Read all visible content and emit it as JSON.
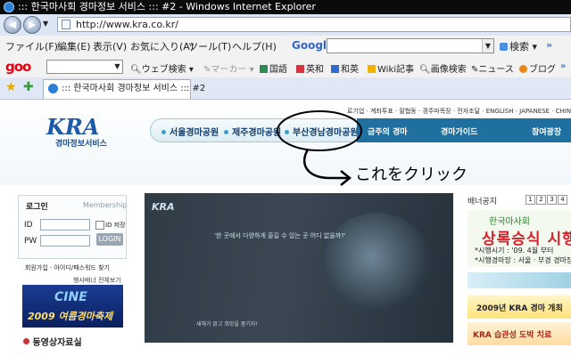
{
  "window": {
    "title": "::: 한국마사회 경마정보 서비스 ::: #2 - Windows Internet Explorer"
  },
  "address": {
    "url": "http://www.kra.co.kr/"
  },
  "menu": [
    "ファイル(F)",
    "編集(E)",
    "表示(V)",
    "お気に入り(A)",
    "ツール(T)",
    "ヘルプ(H)"
  ],
  "google": {
    "logo": "Google",
    "search_label": "検索"
  },
  "goo": {
    "logo": "goo",
    "web_search": "ウェブ検索",
    "marker": "マーカー",
    "items": [
      "国語",
      "英和",
      "和英",
      "Wiki記事",
      "画像検索",
      "ニュース",
      "ブログ"
    ]
  },
  "tab": {
    "title": "::: 한국마사회 경마정보 서비스 ::: #2"
  },
  "page": {
    "logo": "KRA",
    "logo_sub": "경마정보서비스",
    "util_links": "로기업 · 계좌투표 · 말협동 · 경주마목장 · 전자조달 · ENGLISH · JAPANESE · CHINESE",
    "parks": [
      "서울경마공원",
      "제주경마공원",
      "부산경남경마공원"
    ],
    "nav": [
      "금주의 경마",
      "경마가이드",
      "참여광장"
    ],
    "annotation": "これをクリック",
    "login": {
      "title": "로그인",
      "membership": "Membership",
      "id_label": "ID",
      "pw_label": "PW",
      "save_id": "ID 저장",
      "login_button": "LOGIN",
      "links": "회원가입 · 아이디/패스워드 찾기"
    },
    "banner_header": "행사배너 전체보기",
    "banner": {
      "cine": "CINE",
      "text": "2009 여름경마축제"
    },
    "section_title": "동영상자료실",
    "main_image": {
      "logo": "KRA",
      "caption": "'한 곳에서 다양하게 즐길 수 있는 곳 어디 없을까?'",
      "footer": "새해가 밝고 희망을 품기자!"
    },
    "banner_notice": "배너공지",
    "pages": [
      "1",
      "2",
      "3",
      "4"
    ],
    "ad1": {
      "line1": "한국마사회",
      "line2": "상록승식 시행",
      "line3": "*시행시기 : '09. 4월 부터",
      "line4": "*시행경마장 : 서울 · 부경 경마장"
    },
    "ad2": "2009년 KRA 경마 개최",
    "ad3": "KRA 습관성 도박 치료"
  }
}
